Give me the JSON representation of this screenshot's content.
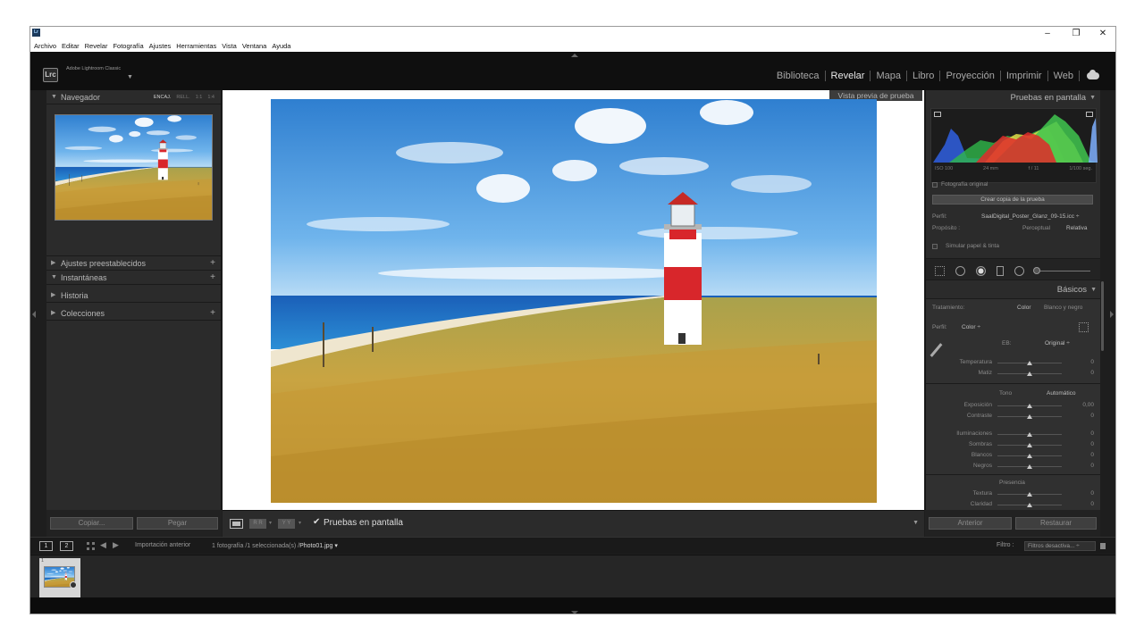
{
  "menu": [
    "Archivo",
    "Editar",
    "Revelar",
    "Fotografía",
    "Ajustes",
    "Herramientas",
    "Vista",
    "Ventana",
    "Ayuda"
  ],
  "window_controls": {
    "minimize": "–",
    "restore": "❐",
    "close": "✕"
  },
  "identity": {
    "badge": "Lrc",
    "product": "Adobe Lightroom Classic"
  },
  "modules": [
    "Biblioteca",
    "Revelar",
    "Mapa",
    "Libro",
    "Proyección",
    "Imprimir",
    "Web"
  ],
  "active_module": "Revelar",
  "left_panel": {
    "navigator": {
      "title": "Navegador",
      "zoom": [
        "ENCAJ.",
        "RELL.",
        "1:1",
        "1:4"
      ],
      "active_zoom": "ENCAJ."
    },
    "sections": [
      {
        "title": "Ajustes preestablecidos",
        "collapsed": true,
        "plus": "+"
      },
      {
        "title": "Instantáneas",
        "collapsed": false,
        "plus": "+"
      },
      {
        "title": "Historia",
        "collapsed": true,
        "plus": ""
      },
      {
        "title": "Colecciones",
        "collapsed": true,
        "plus": "+"
      }
    ],
    "copy_button": "Copiar...",
    "paste_button": "Pegar"
  },
  "center": {
    "preview_label": "Vista previa de prueba",
    "toolbar": {
      "soft_proof_checked": true,
      "soft_proof_label": "Pruebas en pantalla",
      "compare_ab": "Y Y",
      "compare_ba": "R R"
    }
  },
  "right_panel": {
    "soft_proof": {
      "title": "Pruebas en pantalla",
      "exif": [
        "ISO 100",
        "24 mm",
        "f / 11",
        "1/100 seg."
      ],
      "original_photo_label": "Fotografía original",
      "create_copy_button": "Crear copia de la prueba",
      "profile_label": "Perfil:",
      "profile_value": "SaalDigital_Poster_Glanz_09-15.icc ÷",
      "intent_label": "Propósito :",
      "intent_options": [
        "Perceptual",
        "Relativa"
      ],
      "active_intent": "Relativa",
      "simulate_label": "Simular papel & tinta"
    },
    "basic": {
      "title": "Básicos",
      "treatment_label": "Tratamiento:",
      "treatment_options": [
        "Color",
        "Blanco y negro"
      ],
      "active_treatment": "Color",
      "profile_label": "Perfil:",
      "profile_value": "Color ÷",
      "wb_label": "EB:",
      "wb_value": "Original ÷",
      "wb_sliders": [
        {
          "label": "Temperatura",
          "value": "0",
          "level": 0.5
        },
        {
          "label": "Matiz",
          "value": "0",
          "level": 0.5
        }
      ],
      "tone_label": "Tono",
      "auto_label": "Automático",
      "tone_sliders": [
        {
          "label": "Exposición",
          "value": "0,00",
          "level": 0.5
        },
        {
          "label": "Contraste",
          "value": "0",
          "level": 0.5
        }
      ],
      "tone_sliders_2": [
        {
          "label": "Iluminaciones",
          "value": "0",
          "level": 0.5
        },
        {
          "label": "Sombras",
          "value": "0",
          "level": 0.5
        },
        {
          "label": "Blancos",
          "value": "0",
          "level": 0.5
        },
        {
          "label": "Negros",
          "value": "0",
          "level": 0.5
        }
      ],
      "presence_label": "Presencia",
      "presence_sliders": [
        {
          "label": "Textura",
          "value": "0",
          "level": 0.5
        },
        {
          "label": "Claridad",
          "value": "0",
          "level": 0.5
        }
      ]
    },
    "previous_button": "Anterior",
    "reset_button": "Restaurar"
  },
  "filmstrip": {
    "view1": "1",
    "view2": "2",
    "source": "Importación anterior",
    "count_text": "1 fotografía /1 seleccionada(s) /",
    "filename": "Photo01.jpg ▾",
    "filter_label": "Filtro :",
    "filter_value": "Filtros desactiva... ÷",
    "thumb_index": "1"
  },
  "colors": {
    "accent_red": "#d8262b",
    "sky": "#3b8fd8",
    "grass": "#c49a3a",
    "panel": "#2b2b2b"
  }
}
